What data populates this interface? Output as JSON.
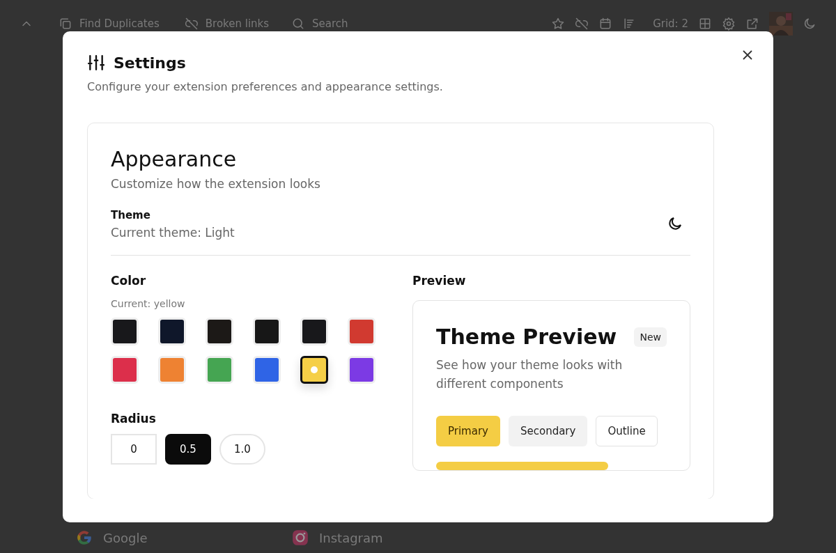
{
  "background": {
    "toolbar": {
      "find_duplicates": "Find Duplicates",
      "broken_links": "Broken links",
      "search": {
        "placeholder": "Search"
      },
      "grid": "Grid: 2"
    },
    "bookmarks": [
      {
        "label": "Google",
        "kind": "google"
      },
      {
        "label": "Instagram",
        "kind": "instagram"
      }
    ]
  },
  "dialog": {
    "title": "Settings",
    "subtitle": "Configure your extension preferences and appearance settings.",
    "appearance": {
      "title": "Appearance",
      "subtitle": "Customize how the extension looks",
      "theme": {
        "label": "Theme",
        "value": "Current theme: Light"
      },
      "color": {
        "label": "Color",
        "current": "Current: yellow",
        "swatches": [
          {
            "color": "#18181b",
            "selected": false
          },
          {
            "color": "#0f172a",
            "selected": false
          },
          {
            "color": "#1c1917",
            "selected": false
          },
          {
            "color": "#171717",
            "selected": false
          },
          {
            "color": "#18181b",
            "selected": false
          },
          {
            "color": "#d13a30",
            "selected": false
          },
          {
            "color": "#dc2f4b",
            "selected": false
          },
          {
            "color": "#ee8232",
            "selected": false
          },
          {
            "color": "#45a552",
            "selected": false
          },
          {
            "color": "#2f64e6",
            "selected": false
          },
          {
            "color": "#f5cf47",
            "selected": true
          },
          {
            "color": "#7c3ae4",
            "selected": false
          }
        ]
      },
      "radius": {
        "label": "Radius",
        "options": [
          {
            "label": "0",
            "kind": "square",
            "selected": false
          },
          {
            "label": "0.5",
            "kind": "rounded",
            "selected": true
          },
          {
            "label": "1.0",
            "kind": "pill",
            "selected": false
          }
        ]
      },
      "preview": {
        "label": "Preview",
        "title": "Theme Preview",
        "badge": "New",
        "text": "See how your theme looks with different components",
        "buttons": [
          {
            "label": "Primary",
            "kind": "primary"
          },
          {
            "label": "Secondary",
            "kind": "secondary"
          },
          {
            "label": "Outline",
            "kind": "outline"
          }
        ]
      }
    }
  }
}
